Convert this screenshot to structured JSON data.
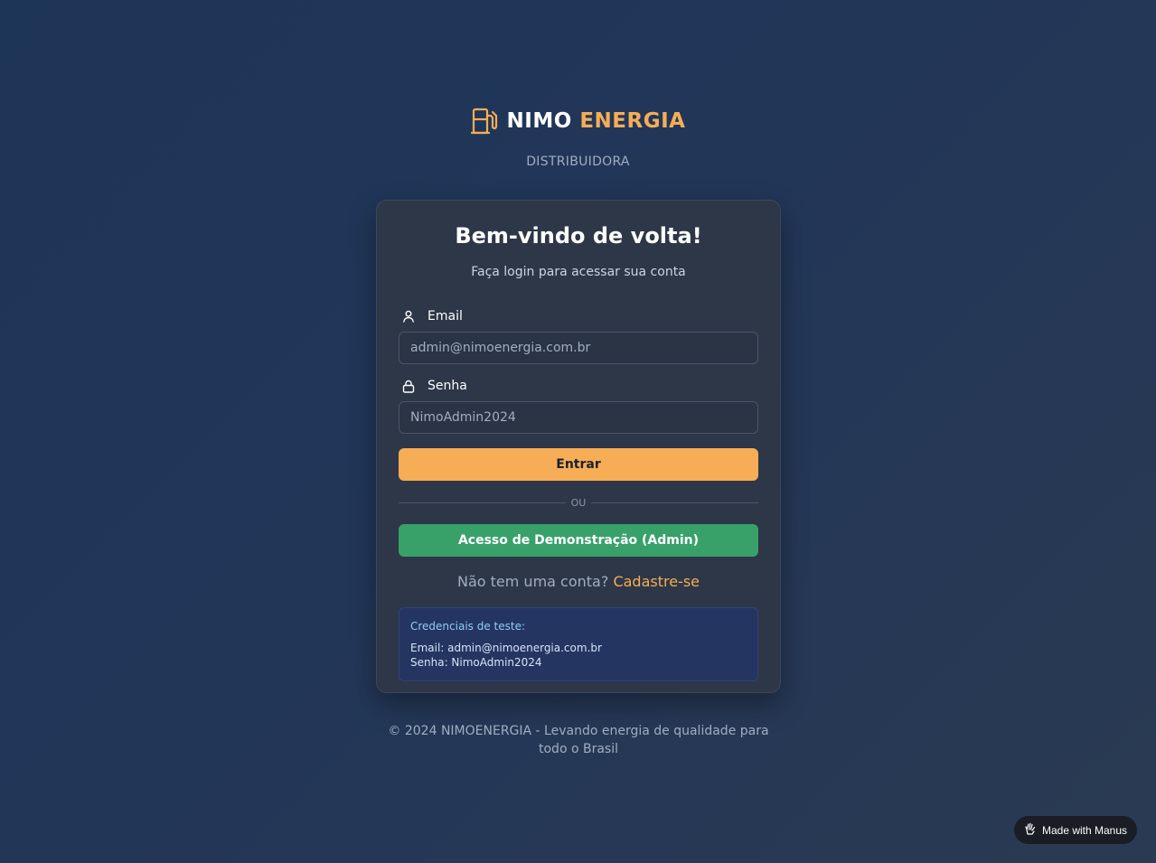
{
  "brand": {
    "name_part1": "NIMO",
    "name_part2": "ENERGIA",
    "tagline": "DISTRIBUIDORA",
    "icon": "fuel-pump-icon",
    "accent_color": "#f6ad55"
  },
  "login": {
    "title": "Bem-vindo de volta!",
    "subtitle": "Faça login para acessar sua conta",
    "email_label": "Email",
    "email_placeholder": "admin@nimoenergia.com.br",
    "email_value": "",
    "password_label": "Senha",
    "password_placeholder": "NimoAdmin2024",
    "password_value": "",
    "submit_label": "Entrar",
    "divider_text": "OU",
    "demo_label": "Acesso de Demonstração (Admin)",
    "signup_prompt": "Não tem uma conta?",
    "signup_link": "Cadastre-se"
  },
  "credentials": {
    "title": "Credenciais de teste:",
    "email_line": "Email: admin@nimoenergia.com.br",
    "password_line": "Senha: NimoAdmin2024"
  },
  "footer": {
    "text": "© 2024 NIMOENERGIA - Levando energia de qualidade para todo o Brasil"
  },
  "badge": {
    "label": "Made with Manus",
    "icon": "manus-hand-icon"
  },
  "colors": {
    "primary_button": "#f6ad55",
    "demo_button": "#38a169",
    "card_background": "#2d3748"
  }
}
